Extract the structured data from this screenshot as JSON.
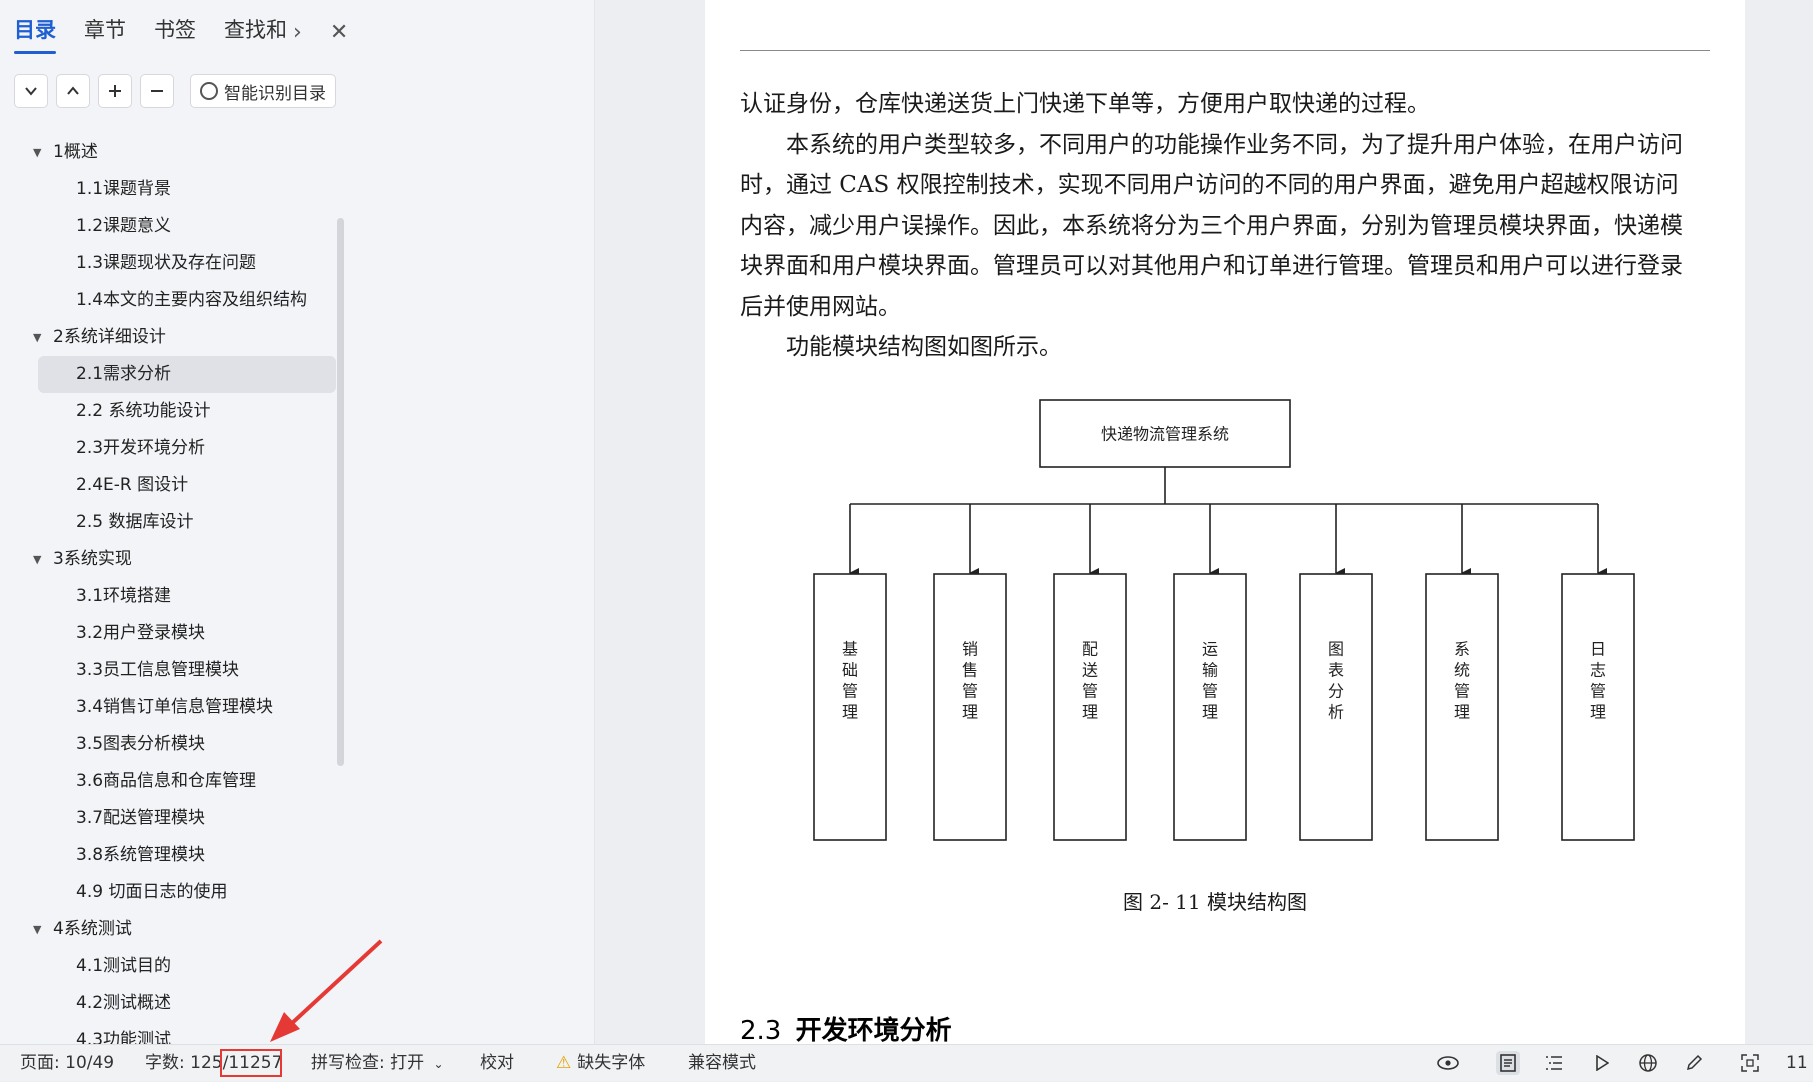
{
  "sidebar": {
    "tabs": [
      "目录",
      "章节",
      "书签",
      "查找和"
    ],
    "smart_button": "智能识别目录",
    "toc": [
      {
        "label": "1概述",
        "level": 1,
        "expanded": true
      },
      {
        "label": "1.1课题背景",
        "level": 2
      },
      {
        "label": "1.2课题意义",
        "level": 2
      },
      {
        "label": "1.3课题现状及存在问题",
        "level": 2
      },
      {
        "label": "1.4本文的主要内容及组织结构",
        "level": 2
      },
      {
        "label": "2系统详细设计",
        "level": 1,
        "expanded": true
      },
      {
        "label": "2.1需求分析",
        "level": 2,
        "selected": true
      },
      {
        "label": "2.2  系统功能设计",
        "level": 2
      },
      {
        "label": "2.3开发环境分析",
        "level": 2
      },
      {
        "label": "2.4E-R 图设计",
        "level": 2
      },
      {
        "label": "2.5  数据库设计",
        "level": 2
      },
      {
        "label": "3系统实现",
        "level": 1,
        "expanded": true
      },
      {
        "label": "3.1环境搭建",
        "level": 2
      },
      {
        "label": "3.2用户登录模块",
        "level": 2
      },
      {
        "label": "3.3员工信息管理模块",
        "level": 2
      },
      {
        "label": "3.4销售订单信息管理模块",
        "level": 2
      },
      {
        "label": "3.5图表分析模块",
        "level": 2
      },
      {
        "label": "3.6商品信息和仓库管理",
        "level": 2
      },
      {
        "label": "3.7配送管理模块",
        "level": 2
      },
      {
        "label": "3.8系统管理模块",
        "level": 2
      },
      {
        "label": "4.9 切面日志的使用",
        "level": 2
      },
      {
        "label": "4系统测试",
        "level": 1,
        "expanded": true
      },
      {
        "label": "4.1测试目的",
        "level": 2
      },
      {
        "label": "4.2测试概述",
        "level": 2
      },
      {
        "label": "4.3功能测试",
        "level": 2
      }
    ]
  },
  "document": {
    "paragraphs": [
      "认证身份，仓库快递送货上门快递下单等，方便用户取快递的过程。",
      "本系统的用户类型较多，不同用户的功能操作业务不同，为了提升用户体验，在用户访问时，通过 CAS 权限控制技术，实现不同用户访问的不同的用户界面，避免用户超越权限访问内容，减少用户误操作。因此，本系统将分为三个用户界面，分别为管理员模块界面，快递模块界面和用户模块界面。管理员可以对其他用户和订单进行管理。管理员和用户可以进行登录后并使用网站。",
      "功能模块结构图如图所示。"
    ],
    "diagram": {
      "root": "快递物流管理系统",
      "children": [
        "基础管理",
        "销售管理",
        "配送管理",
        "运输管理",
        "图表分析",
        "系统管理",
        "日志管理"
      ]
    },
    "caption": "图  2- 11 模块结构图",
    "next_section": {
      "number": "2.3",
      "title": "开发环境分析"
    }
  },
  "statusbar": {
    "page": "页面: 10/49",
    "word_count_label": "字数: 125",
    "word_count_total": "/11257",
    "spell_check": "拼写检查: 打开",
    "proofread": "校对",
    "missing_font": "缺失字体",
    "compat_mode": "兼容模式",
    "zoom": "11"
  },
  "colors": {
    "accent": "#1f5fd1",
    "highlight": "#e53935"
  }
}
